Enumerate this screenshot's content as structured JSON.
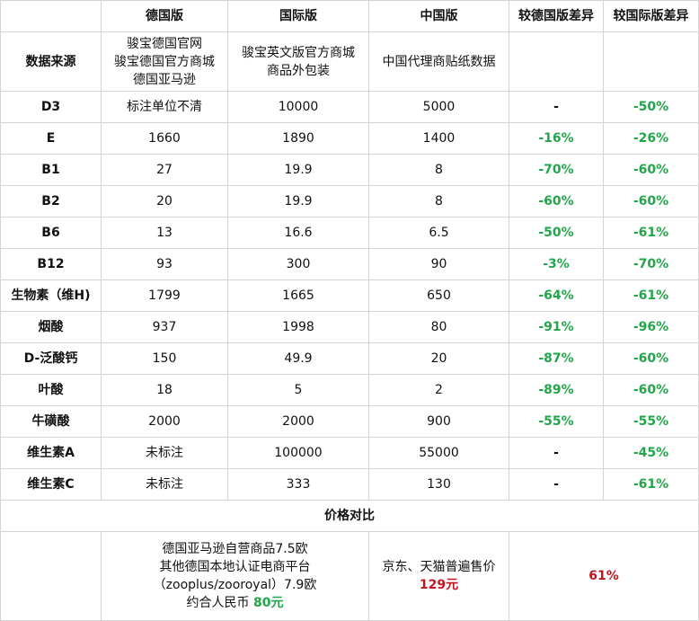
{
  "colors": {
    "negative_diff": "#22a64a",
    "price_highlight": "#c0161f",
    "border": "#d4d4d4"
  },
  "header": {
    "corner": "",
    "german": "德国版",
    "international": "国际版",
    "china": "中国版",
    "diff_german": "较德国版差异",
    "diff_international": "较国际版差异"
  },
  "source": {
    "label": "数据来源",
    "german": [
      "骏宝德国官网",
      "骏宝德国官方商城",
      "德国亚马逊"
    ],
    "international": [
      "骏宝英文版官方商城",
      "商品外包装"
    ],
    "china": "中国代理商贴纸数据",
    "diff_german": "",
    "diff_international": ""
  },
  "rows": [
    {
      "name": "D3",
      "german": "标注单位不清",
      "international": "10000",
      "china": "5000",
      "diff_german": "-",
      "diff_international": "-50%"
    },
    {
      "name": "E",
      "german": "1660",
      "international": "1890",
      "china": "1400",
      "diff_german": "-16%",
      "diff_international": "-26%"
    },
    {
      "name": "B1",
      "german": "27",
      "international": "19.9",
      "china": "8",
      "diff_german": "-70%",
      "diff_international": "-60%"
    },
    {
      "name": "B2",
      "german": "20",
      "international": "19.9",
      "china": "8",
      "diff_german": "-60%",
      "diff_international": "-60%"
    },
    {
      "name": "B6",
      "german": "13",
      "international": "16.6",
      "china": "6.5",
      "diff_german": "-50%",
      "diff_international": "-61%"
    },
    {
      "name": "B12",
      "german": "93",
      "international": "300",
      "china": "90",
      "diff_german": "-3%",
      "diff_international": "-70%"
    },
    {
      "name": "生物素（维H)",
      "german": "1799",
      "international": "1665",
      "china": "650",
      "diff_german": "-64%",
      "diff_international": "-61%"
    },
    {
      "name": "烟酸",
      "german": "937",
      "international": "1998",
      "china": "80",
      "diff_german": "-91%",
      "diff_international": "-96%"
    },
    {
      "name": "D-泛酸钙",
      "german": "150",
      "international": "49.9",
      "china": "20",
      "diff_german": "-87%",
      "diff_international": "-60%"
    },
    {
      "name": "叶酸",
      "german": "18",
      "international": "5",
      "china": "2",
      "diff_german": "-89%",
      "diff_international": "-60%"
    },
    {
      "name": "牛磺酸",
      "german": "2000",
      "international": "2000",
      "china": "900",
      "diff_german": "-55%",
      "diff_international": "-55%"
    },
    {
      "name": "维生素A",
      "german": "未标注",
      "international": "100000",
      "china": "55000",
      "diff_german": "-",
      "diff_international": "-45%"
    },
    {
      "name": "维生素C",
      "german": "未标注",
      "international": "333",
      "china": "130",
      "diff_german": "-",
      "diff_international": "-61%"
    }
  ],
  "section_title": "价格对比",
  "price": {
    "corner": "",
    "german_lines": [
      "德国亚马逊自营商品7.5欧",
      "其他德国本地认证电商平台",
      "（zooplus/zooroyal）7.9欧"
    ],
    "german_rmb_prefix": "约合人民币 ",
    "german_rmb_value": "80元",
    "china_text": "京东、天猫普遍售价",
    "china_value": "129元",
    "diff": "61%"
  }
}
